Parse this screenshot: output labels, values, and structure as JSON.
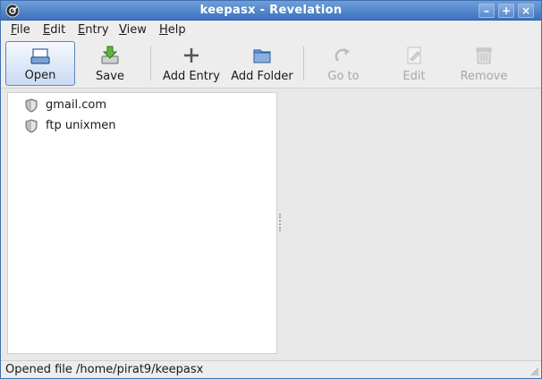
{
  "window": {
    "title": "keepasx - Revelation",
    "controls": [
      "minimize-icon",
      "maximize-icon",
      "close-icon"
    ]
  },
  "menubar": {
    "items": [
      {
        "label": "File",
        "mnemonic": "F",
        "rest": "ile"
      },
      {
        "label": "Edit",
        "mnemonic": "E",
        "rest": "dit"
      },
      {
        "label": "Entry",
        "mnemonic": "E",
        "rest": "ntry"
      },
      {
        "label": "View",
        "mnemonic": "V",
        "rest": "iew"
      },
      {
        "label": "Help",
        "mnemonic": "H",
        "rest": "elp"
      }
    ]
  },
  "toolbar": {
    "open": {
      "label": "Open",
      "icon": "open-icon",
      "state": "pressed"
    },
    "save": {
      "label": "Save",
      "icon": "save-icon",
      "state": "enabled"
    },
    "add_entry": {
      "label": "Add Entry",
      "icon": "plus-icon",
      "state": "enabled"
    },
    "add_folder": {
      "label": "Add Folder",
      "icon": "folder-icon",
      "state": "enabled"
    },
    "goto": {
      "label": "Go to",
      "icon": "redo-arrow-icon",
      "state": "disabled"
    },
    "edit": {
      "label": "Edit",
      "icon": "edit-icon",
      "state": "disabled"
    },
    "remove": {
      "label": "Remove",
      "icon": "trash-icon",
      "state": "disabled"
    }
  },
  "tree": {
    "entries": [
      {
        "label": "gmail.com",
        "icon": "shield-icon"
      },
      {
        "label": "ftp  unixmen",
        "icon": "shield-icon"
      }
    ]
  },
  "statusbar": {
    "text": "Opened file /home/pirat9/keepasx"
  },
  "colors": {
    "titlebar": "#3b72c0",
    "accent": "#5c87c2",
    "tree_bg": "#ffffff",
    "disabled_text": "#a8a8a8"
  }
}
